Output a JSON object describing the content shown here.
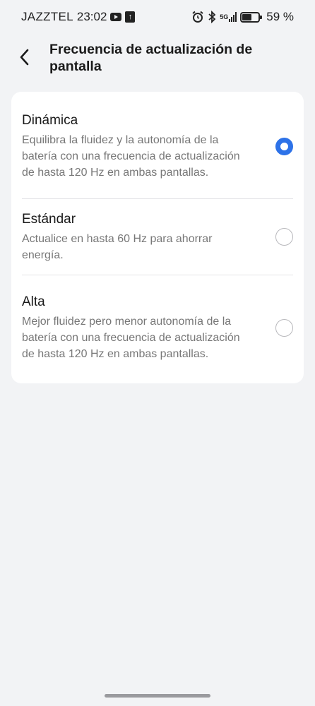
{
  "status_bar": {
    "carrier": "JAZZTEL",
    "time": "23:02",
    "network": "5G",
    "battery_text": "59 %",
    "battery_level": 0.59,
    "icons": [
      "youtube-icon",
      "upload-icon",
      "alarm-icon",
      "bluetooth-icon",
      "signal-icon",
      "battery-icon"
    ]
  },
  "header": {
    "back_icon": "chevron-left-icon",
    "title": "Frecuencia de actualización de pantalla"
  },
  "options": [
    {
      "title": "Dinámica",
      "description": "Equilibra la fluidez y la autonomía de la batería con una frecuencia de actualización de hasta 120 Hz en ambas pantallas.",
      "selected": true
    },
    {
      "title": "Estándar",
      "description": "Actualice en hasta 60 Hz para ahorrar energía.",
      "selected": false
    },
    {
      "title": "Alta",
      "description": "Mejor fluidez pero menor autonomía de la batería con una frecuencia de actualización de hasta 120 Hz en ambas pantallas.",
      "selected": false
    }
  ],
  "colors": {
    "accent": "#2d72e8",
    "background": "#f2f3f5",
    "card": "#ffffff"
  }
}
